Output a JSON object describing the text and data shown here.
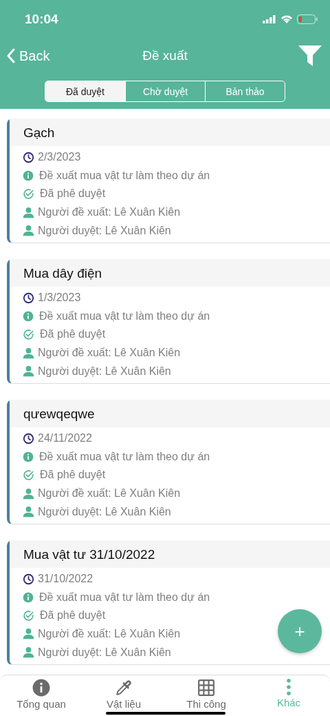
{
  "status_bar": {
    "time": "10:04"
  },
  "nav": {
    "back": "Back",
    "title": "Đề xuất"
  },
  "tabs": [
    {
      "label": "Đã duyệt",
      "selected": true
    },
    {
      "label": "Chờ duyệt",
      "selected": false
    },
    {
      "label": "Bản thảo",
      "selected": false
    }
  ],
  "cards": [
    {
      "title": "Gạch",
      "rows": [
        {
          "kind": "date",
          "text": "2/3/2023"
        },
        {
          "kind": "info",
          "text": "Đề xuất mua vật tư làm theo dự án"
        },
        {
          "kind": "status",
          "text": "Đã phê duyệt"
        },
        {
          "kind": "person",
          "text": "Người đề xuất: Lê Xuân Kiên"
        },
        {
          "kind": "person",
          "text": "Người duyệt: Lê Xuân Kiên"
        }
      ]
    },
    {
      "title": "Mua dây điện",
      "rows": [
        {
          "kind": "date",
          "text": "1/3/2023"
        },
        {
          "kind": "info",
          "text": "Đề xuất mua vật tư làm theo dự án"
        },
        {
          "kind": "status",
          "text": "Đã phê duyệt"
        },
        {
          "kind": "person",
          "text": "Người đề xuất: Lê Xuân Kiên"
        },
        {
          "kind": "person",
          "text": "Người duyệt: Lê Xuân Kiên"
        }
      ]
    },
    {
      "title": "qưewqeqwe",
      "rows": [
        {
          "kind": "date",
          "text": "24/11/2022"
        },
        {
          "kind": "info",
          "text": "Đề xuất mua vật tư làm theo dự án"
        },
        {
          "kind": "status",
          "text": "Đã phê duyệt"
        },
        {
          "kind": "person",
          "text": "Người đề xuất: Lê Xuân Kiên"
        },
        {
          "kind": "person",
          "text": "Người duyệt: Lê Xuân Kiên"
        }
      ]
    },
    {
      "title": "Mua vật tư 31/10/2022",
      "rows": [
        {
          "kind": "date",
          "text": "31/10/2022"
        },
        {
          "kind": "info",
          "text": "Đề xuất mua vật tư làm theo dự án"
        },
        {
          "kind": "status",
          "text": "Đã phê duyệt"
        },
        {
          "kind": "person",
          "text": "Người đề xuất: Lê Xuân Kiên"
        },
        {
          "kind": "person",
          "text": "Người duyệt: Lê Xuân Kiên"
        }
      ]
    }
  ],
  "fab": {
    "label": "+"
  },
  "bottom_tabs": [
    {
      "kind": "info",
      "label": "Tổng quan",
      "selected": false
    },
    {
      "kind": "dropper",
      "label": "Vật liệu",
      "selected": false
    },
    {
      "kind": "grid",
      "label": "Thi công",
      "selected": false
    },
    {
      "kind": "more",
      "label": "Khác",
      "selected": true
    }
  ]
}
